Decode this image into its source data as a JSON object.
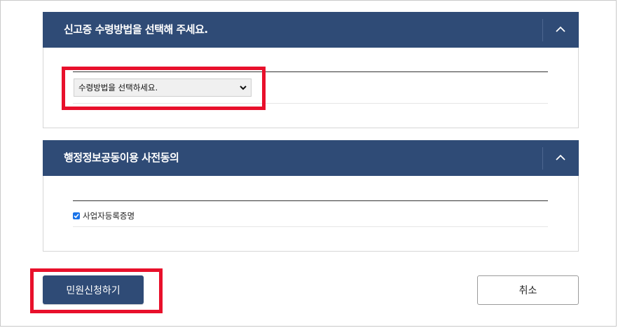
{
  "receipt_section": {
    "title": "신고증 수령방법을 선택해 주세요.",
    "toggle_icon": "chevron-up-icon",
    "select": {
      "selected_value": "수령방법을 선택하세요.",
      "icon": "chevron-down-icon"
    }
  },
  "consent_section": {
    "title": "행정정보공동이용 사전동의",
    "toggle_icon": "chevron-up-icon",
    "checkbox": {
      "label": "사업자등록증명",
      "checked": true
    }
  },
  "actions": {
    "submit_label": "민원신청하기",
    "cancel_label": "취소"
  },
  "colors": {
    "header_bg": "#2f4b76",
    "highlight": "#e8102b",
    "checkbox": "#1a73e8"
  }
}
